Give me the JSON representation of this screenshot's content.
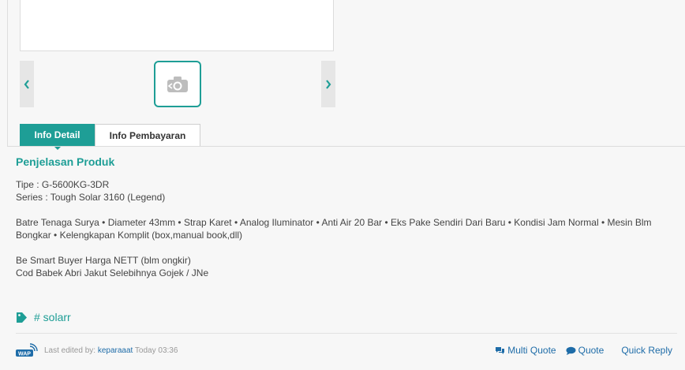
{
  "gallery": {
    "prev_icon": "chevron-left-icon",
    "next_icon": "chevron-right-icon",
    "thumb_icon": "camera-icon"
  },
  "tabs": [
    {
      "label": "Info Detail",
      "active": true
    },
    {
      "label": "Info Pembayaran",
      "active": false
    }
  ],
  "product": {
    "section_title": "Penjelasan Produk",
    "lines": [
      "Tipe : G-5600KG-3DR",
      "Series : Tough Solar 3160 (Legend)",
      "",
      "Batre Tenaga Surya • Diameter 43mm • Strap Karet • Analog Iluminator • Anti Air 20 Bar • Eks Pake Sendiri Dari Baru • Kondisi Jam Normal • Mesin Blm Bongkar • Kelengkapan Komplit (box,manual book,dll)",
      "",
      "Be Smart Buyer Harga NETT (blm ongkir)",
      "Cod Babek Abri Jakut Selebihnya Gojek / JNe"
    ]
  },
  "tag": {
    "icon": "tag-icon",
    "label": "# solarr"
  },
  "footer": {
    "wap_badge": "WAP",
    "edited_label": "Last edited by:",
    "edited_user": "keparaaat",
    "edited_time": "Today 03:36",
    "multi_quote": "Multi Quote",
    "quote": "Quote",
    "quick_reply": "Quick Reply"
  },
  "colors": {
    "accent": "#1e9e96",
    "link": "#1e6ca8"
  }
}
